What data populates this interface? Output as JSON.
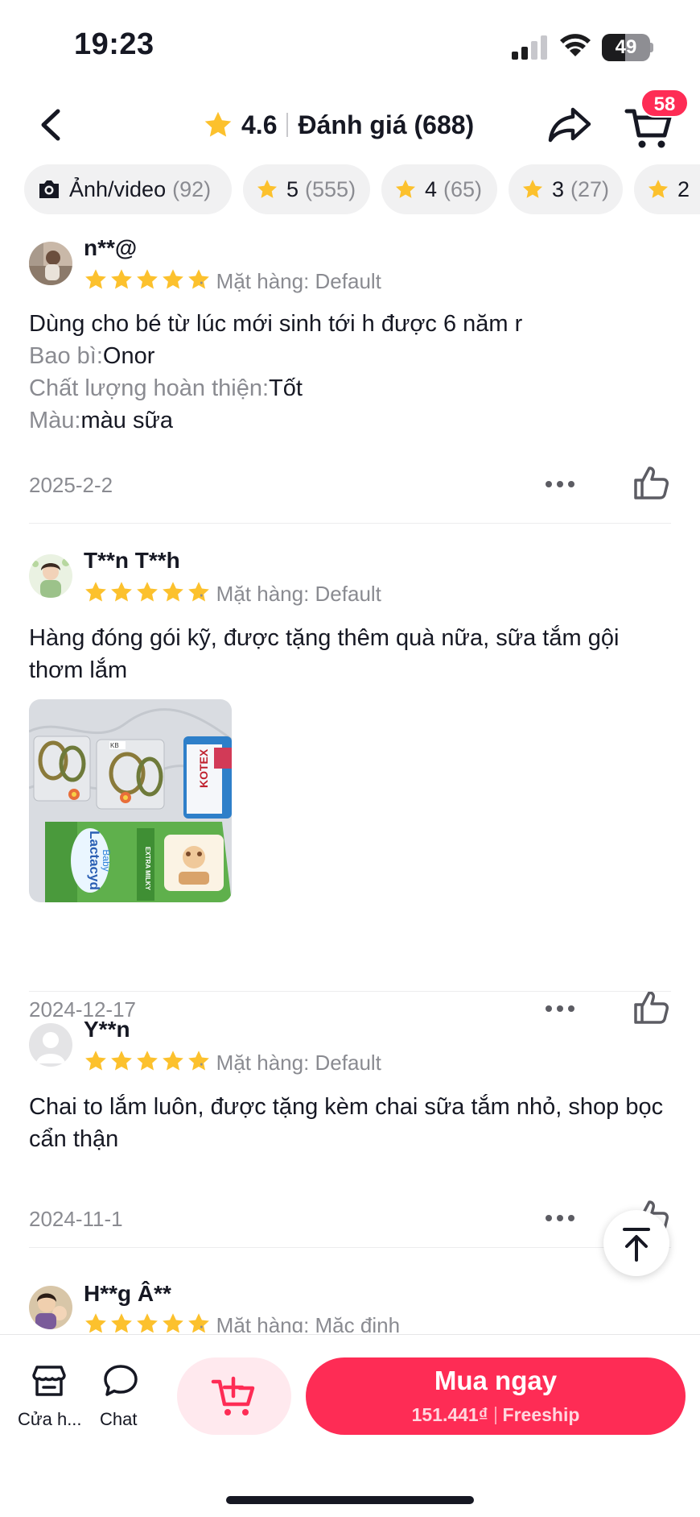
{
  "status_bar": {
    "time": "19:23",
    "battery": "49",
    "battery_level": 0.49
  },
  "header": {
    "rating": "4.6",
    "title": "Đánh giá (688)",
    "cart_count": "58"
  },
  "filters": [
    {
      "label": "Ảnh/video",
      "count": "(92)",
      "icon": "camera-icon"
    },
    {
      "label": "5",
      "count": "(555)",
      "icon": "star-icon"
    },
    {
      "label": "4",
      "count": "(65)",
      "icon": "star-icon"
    },
    {
      "label": "3",
      "count": "(27)",
      "icon": "star-icon"
    },
    {
      "label": "2",
      "count": "",
      "icon": "star-icon"
    }
  ],
  "reviews": [
    {
      "user": "n**@",
      "rating": 5,
      "variant": "Mặt hàng: Default",
      "text": "Dùng cho bé từ lúc mới sinh tới h được 6 năm r",
      "attributes": [
        {
          "key": "Bao bì:",
          "value": "Onor"
        },
        {
          "key": "Chất lượng hoàn thiện:",
          "value": "Tốt"
        },
        {
          "key": "Màu:",
          "value": "màu sữa"
        }
      ],
      "date": "2025-2-2"
    },
    {
      "user": "T**n T**h",
      "rating": 5,
      "variant": "Mặt hàng: Default",
      "text": "Hàng đóng gói kỹ, được tặng thêm quà nữa, sữa tắm gội thơm lắm",
      "photo_labels": {
        "brand1": "Lactacyd",
        "brand1_sub": "Baby",
        "brand2": "KOTEX",
        "pack_text": "EXTRA MILKY"
      },
      "date": "2024-12-17"
    },
    {
      "user": "Y**n",
      "rating": 5,
      "variant": "Mặt hàng: Default",
      "text": "Chai to lắm luôn, được tặng kèm chai sữa tắm nhỏ, shop bọc cẩn thận",
      "date": "2024-11-1"
    },
    {
      "user": "H**g Â**",
      "rating": 5,
      "variant": "Mặt hàng: Mặc định"
    }
  ],
  "bottom_bar": {
    "shop_label": "Cửa h...",
    "chat_label": "Chat",
    "buy_label": "Mua ngay",
    "price": "151.441₫",
    "shipping": "Freeship"
  },
  "colors": {
    "accent": "#fe2c55",
    "star": "#fcc12d",
    "muted_text": "#8a8b91"
  }
}
